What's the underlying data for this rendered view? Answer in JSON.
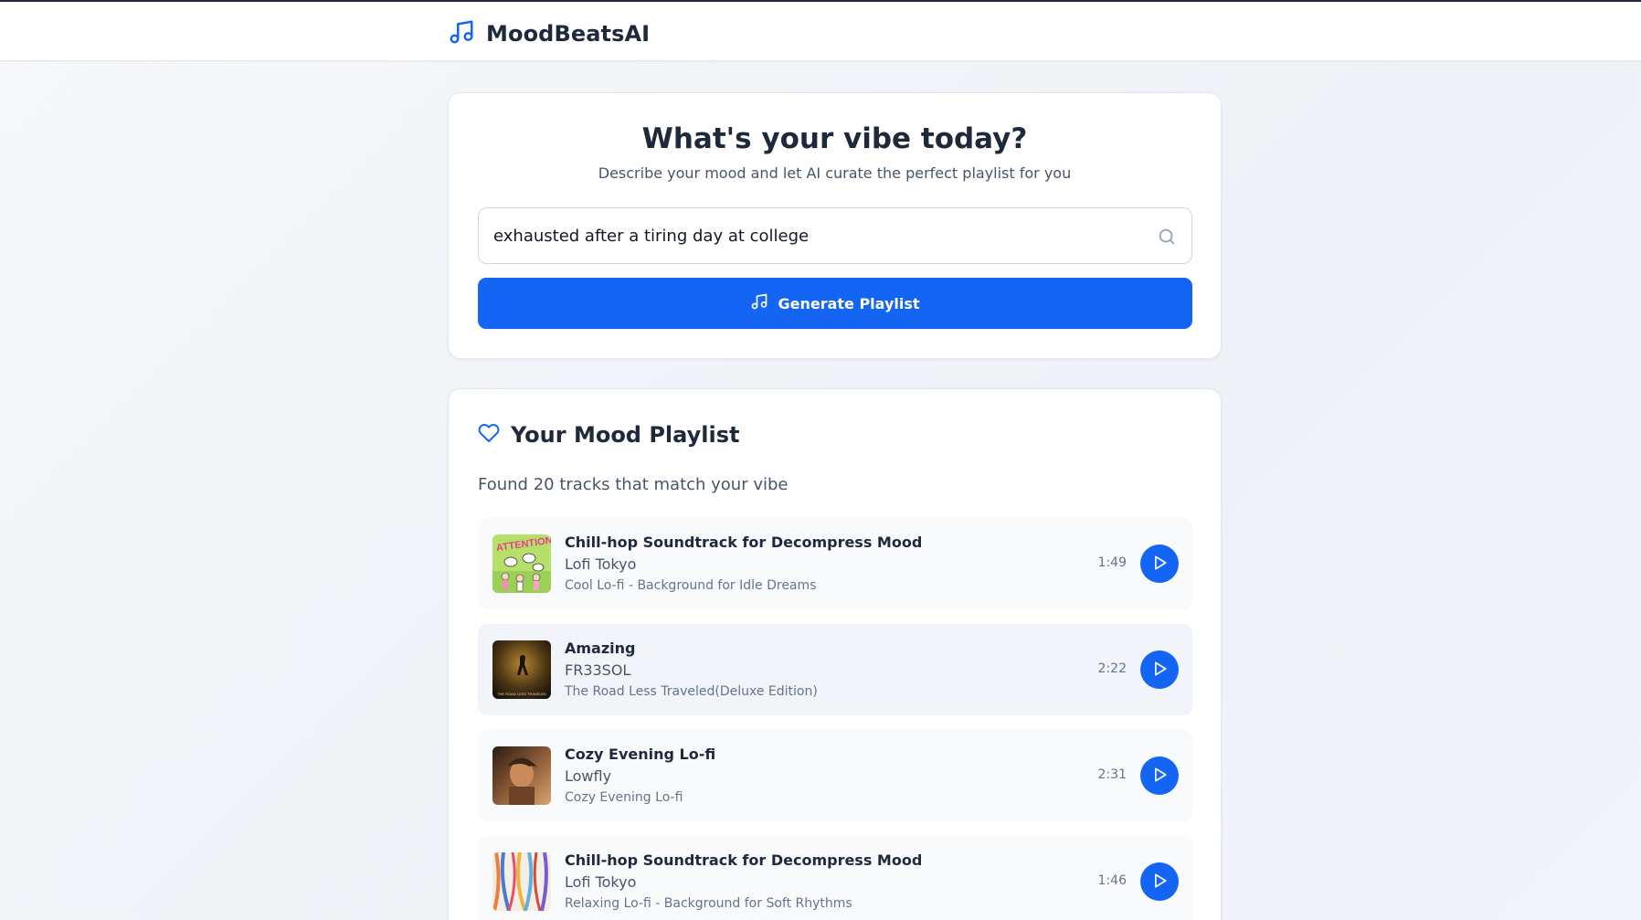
{
  "app": {
    "name": "MoodBeatsAI",
    "brand_color": "#1565f5"
  },
  "hero": {
    "title": "What's your vibe today?",
    "subtitle": "Describe your mood and let AI curate the perfect playlist for you"
  },
  "search": {
    "value": "exhausted after a tiring day at college",
    "icon": "search-icon"
  },
  "generate_button": {
    "label": "Generate Playlist",
    "icon": "music-note-icon"
  },
  "playlist": {
    "title": "Your Mood Playlist",
    "icon": "heart-icon",
    "count_text": "Found 20 tracks that match your vibe",
    "tracks": [
      {
        "title": "Chill-hop Soundtrack for Decompress Mood",
        "artist": "Lofi Tokyo",
        "album": "Cool Lo-fi - Background for Idle Dreams",
        "duration": "1:49",
        "artwork_text": "ATTENTION"
      },
      {
        "title": "Amazing",
        "artist": "FR33SOL",
        "album": "The Road Less Traveled(Deluxe Edition)",
        "duration": "2:22",
        "artwork_text": "THE ROAD LESS TRAVELED"
      },
      {
        "title": "Cozy Evening Lo-fi",
        "artist": "Lowfly",
        "album": "Cozy Evening Lo-fi",
        "duration": "2:31"
      },
      {
        "title": "Chill-hop Soundtrack for Decompress Mood",
        "artist": "Lofi Tokyo",
        "album": "Relaxing Lo-fi - Background for Soft Rhythms",
        "duration": "1:46"
      }
    ]
  }
}
